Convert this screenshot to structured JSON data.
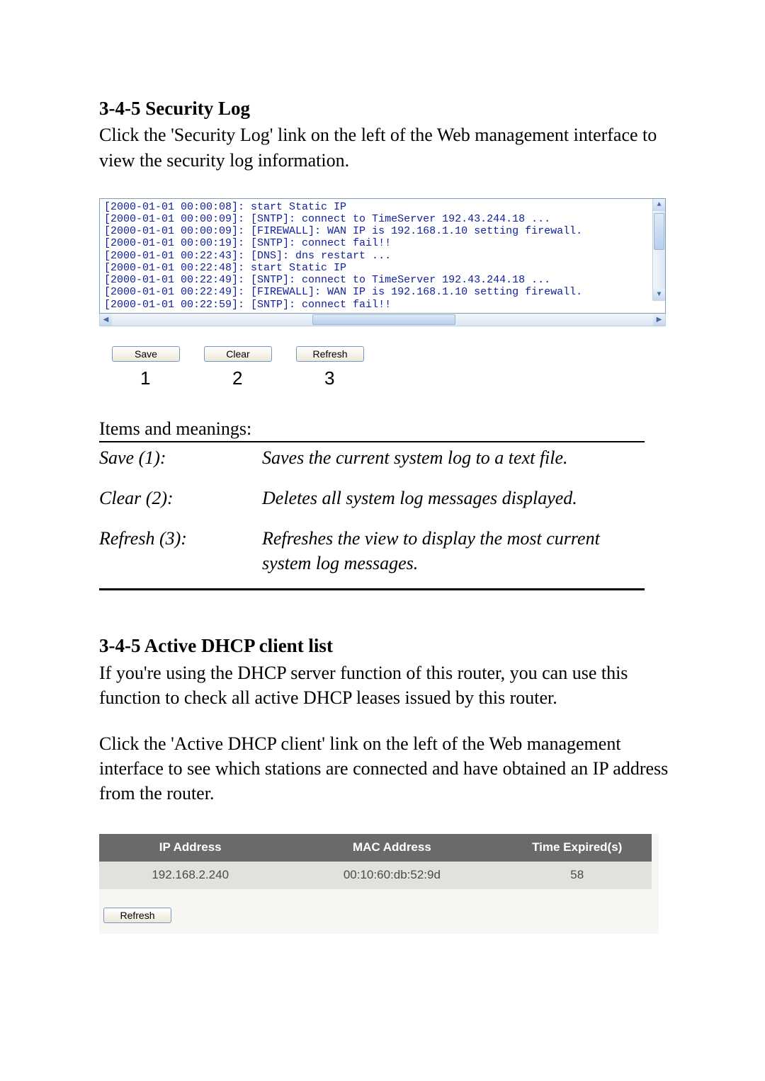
{
  "section_security": {
    "heading": "3-4-5 Security Log",
    "intro": "Click the 'Security Log' link on the left of the Web management interface to view the security log information."
  },
  "log_lines": [
    "[2000-01-01 00:00:08]: start Static IP",
    "[2000-01-01 00:00:09]: [SNTP]: connect to TimeServer 192.43.244.18 ...",
    "[2000-01-01 00:00:09]: [FIREWALL]: WAN IP is 192.168.1.10 setting firewall.",
    "[2000-01-01 00:00:19]: [SNTP]: connect fail!!",
    "[2000-01-01 00:22:43]: [DNS]: dns restart ...",
    "[2000-01-01 00:22:48]: start Static IP",
    "[2000-01-01 00:22:49]: [SNTP]: connect to TimeServer 192.43.244.18 ...",
    "[2000-01-01 00:22:49]: [FIREWALL]: WAN IP is 192.168.1.10 setting firewall.",
    "[2000-01-01 00:22:59]: [SNTP]: connect fail!!"
  ],
  "buttons": {
    "save": "Save",
    "clear": "Clear",
    "refresh": "Refresh"
  },
  "number_labels": {
    "n1": "1",
    "n2": "2",
    "n3": "3"
  },
  "items_heading": "Items and meanings:",
  "items": [
    {
      "term": "Save (1):",
      "desc": "Saves the current system log to a text file."
    },
    {
      "term": "Clear (2):",
      "desc": "Deletes all system log messages displayed."
    },
    {
      "term": "Refresh (3):",
      "desc": "Refreshes the view to display the most current system log messages."
    }
  ],
  "section_dhcp": {
    "heading": "3-4-5 Active DHCP client list",
    "p1": "If you're using the DHCP server function of this router, you can use this function to check all active DHCP leases issued by this router.",
    "p2": "Click the 'Active DHCP client' link on the left of the Web management interface to see which stations are connected and have obtained an IP address from the router."
  },
  "dhcp_table": {
    "headers": [
      "IP Address",
      "MAC Address",
      "Time Expired(s)"
    ],
    "rows": [
      [
        "192.168.2.240",
        "00:10:60:db:52:9d",
        "58"
      ]
    ],
    "refresh_label": "Refresh"
  }
}
